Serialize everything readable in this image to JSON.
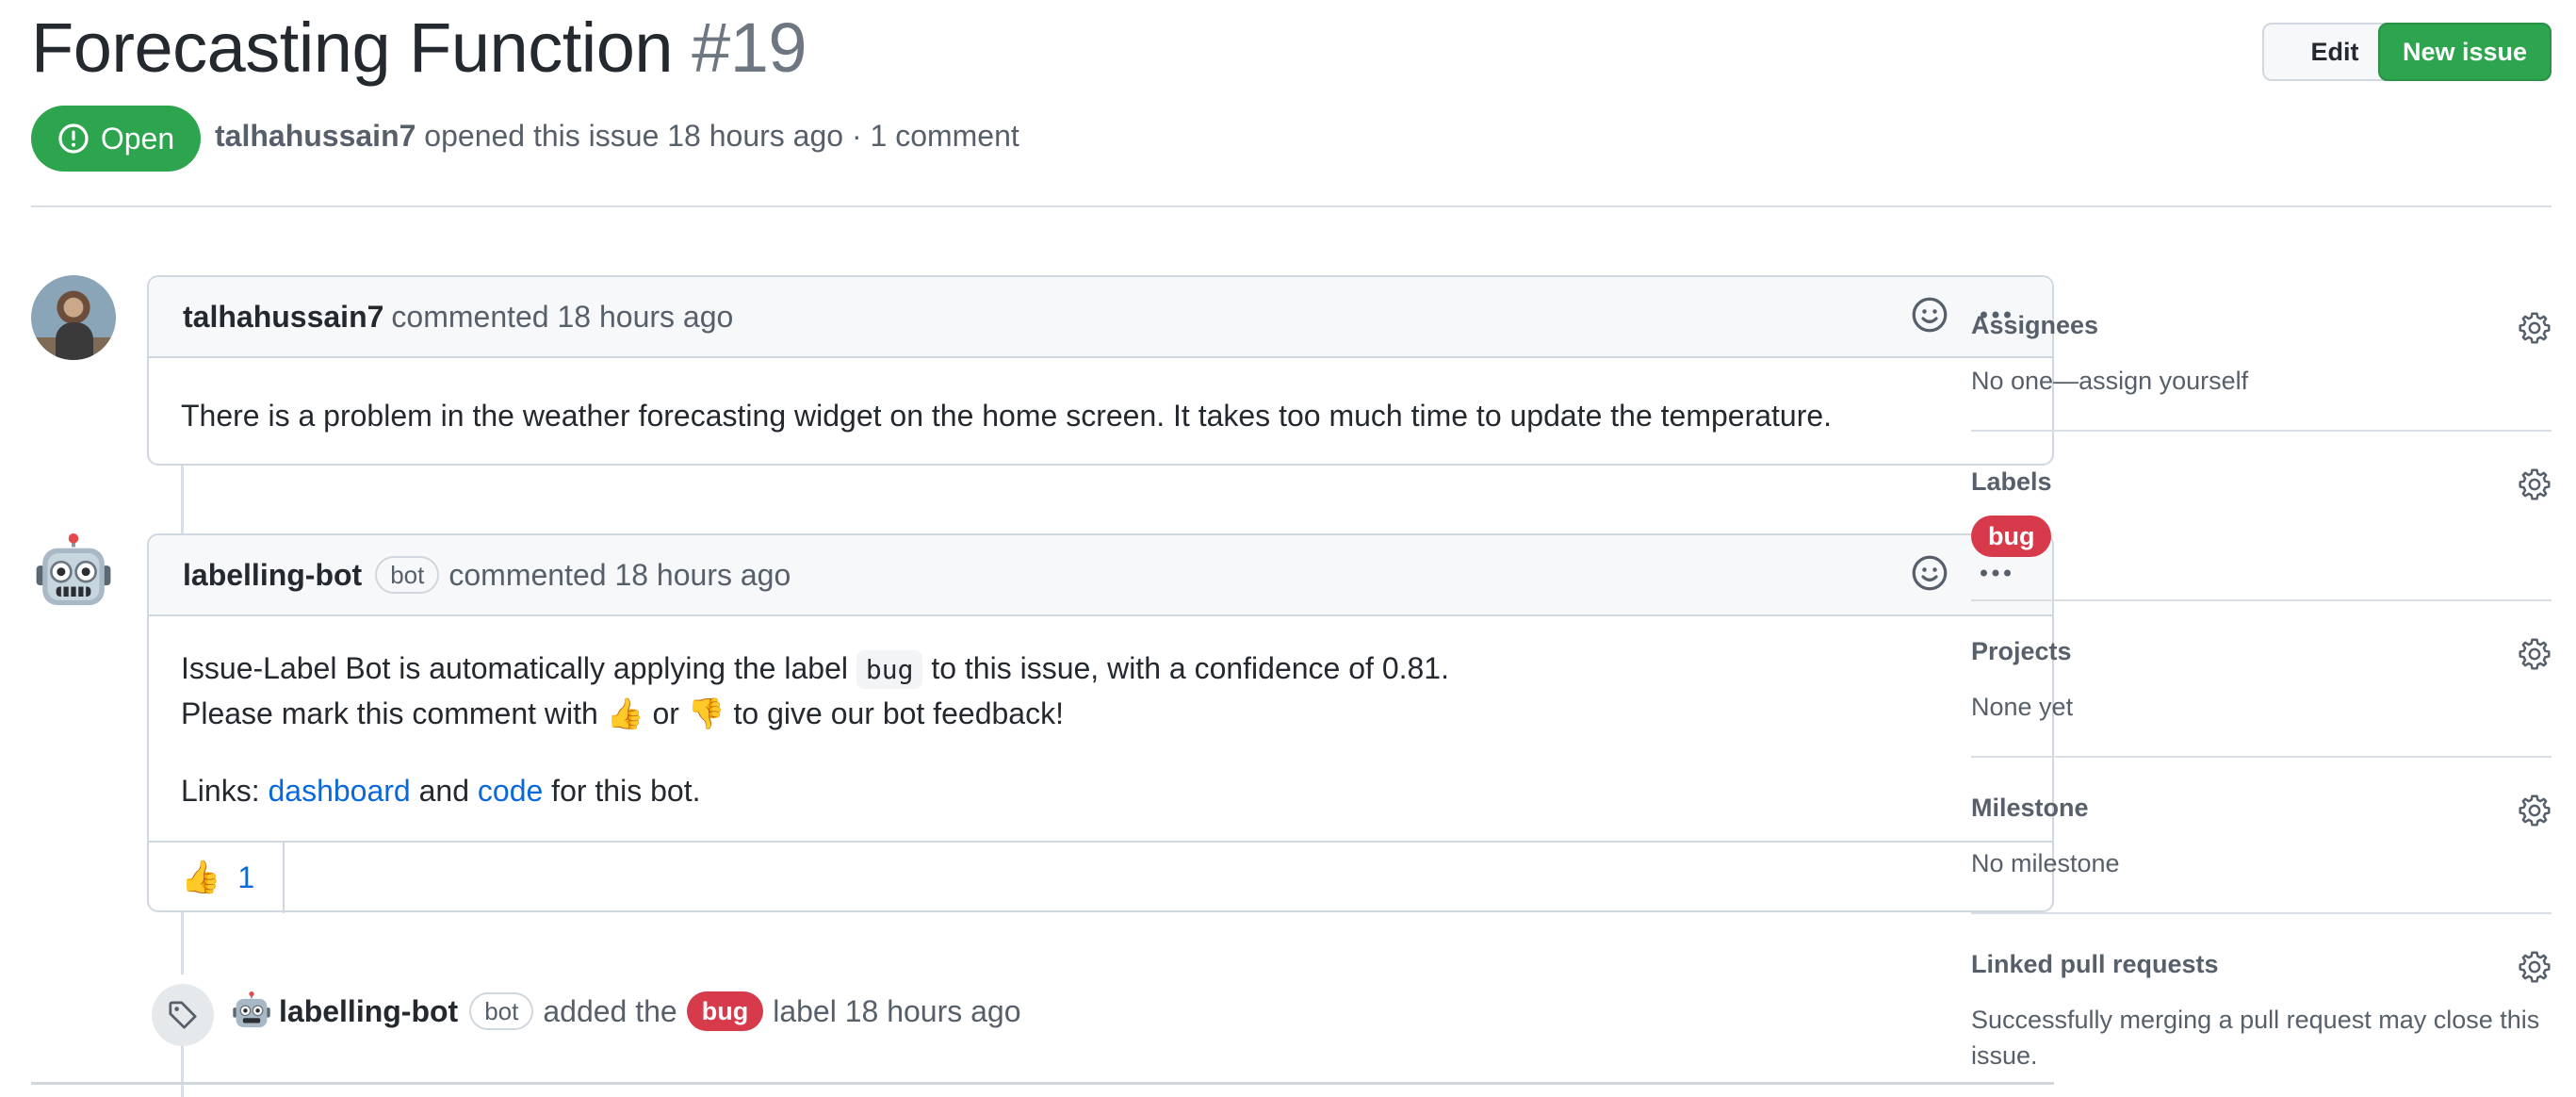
{
  "header": {
    "title": "Forecasting Function",
    "number": "#19",
    "edit_label": "Edit",
    "new_issue_label": "New issue",
    "state": "Open",
    "author": "talhahussain7",
    "meta_text": "opened this issue 18 hours ago · 1 comment"
  },
  "comments": [
    {
      "author": "talhahussain7",
      "meta": "commented 18 hours ago",
      "body": "There is a problem in the weather forecasting widget on the home screen. It takes too much time to update the temperature."
    },
    {
      "author": "labelling-bot",
      "tag": "bot",
      "meta": "commented 18 hours ago",
      "line1_pre": "Issue-Label Bot is automatically applying the label",
      "line1_code": "bug",
      "line1_post": "to this issue, with a confidence of 0.81.",
      "line2_pre": "Please mark this comment with",
      "line2_mid": "or",
      "line2_post": "to give our bot feedback!",
      "links_pre": "Links:",
      "link1": "dashboard",
      "links_and": "and",
      "link2": "code",
      "links_post": "for this bot.",
      "reaction_count": "1"
    }
  ],
  "event": {
    "actor": "labelling-bot",
    "tag": "bot",
    "pre": "added the",
    "label": "bug",
    "post": "label 18 hours ago"
  },
  "sidebar": {
    "assignees_title": "Assignees",
    "assignees_value": "No one—assign yourself",
    "labels_title": "Labels",
    "labels_value": "bug",
    "projects_title": "Projects",
    "projects_value": "None yet",
    "milestone_title": "Milestone",
    "milestone_value": "No milestone",
    "linked_title": "Linked pull requests",
    "linked_value": "Successfully merging a pull request may close this issue."
  },
  "colors": {
    "open_green": "#2da44e",
    "bug_red": "#d73a4a",
    "link_blue": "#0969da"
  },
  "icons": [
    "issue-open-icon",
    "smiley-icon",
    "kebab-horizontal-icon",
    "robot-icon",
    "tag-icon",
    "gear-icon",
    "thumbs-up-icon",
    "thumbs-down-icon"
  ]
}
